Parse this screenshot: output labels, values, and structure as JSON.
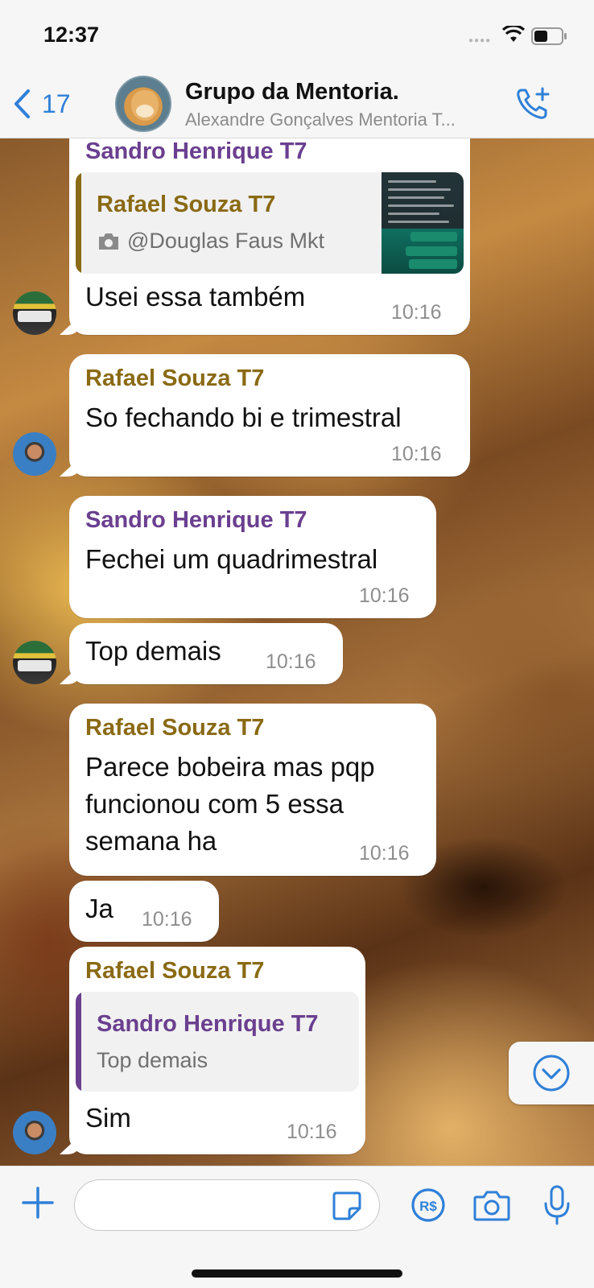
{
  "status_bar": {
    "time": "12:37"
  },
  "header": {
    "back_count": "17",
    "title": "Grupo da Mentoria.",
    "subtitle": "Alexandre Gonçalves Mentoria T..."
  },
  "messages": [
    {
      "sender": "Sandro Henrique T7",
      "quote": {
        "name": "Rafael Souza T7",
        "text": "@Douglas Faus Mkt",
        "has_photo": true
      },
      "text": "Usei essa também",
      "time": "10:16"
    },
    {
      "sender": "Rafael Souza T7",
      "text": "So fechando bi e trimestral",
      "time": "10:16"
    },
    {
      "sender": "Sandro Henrique T7",
      "text": "Fechei um quadrimestral",
      "time": "10:16"
    },
    {
      "text": "Top demais",
      "time": "10:16"
    },
    {
      "sender": "Rafael Souza T7",
      "lines": [
        "Parece bobeira mas pqp",
        "funcionou com 5 essa",
        "semana ha"
      ],
      "time": "10:16"
    },
    {
      "text": "Ja",
      "time": "10:16"
    },
    {
      "sender": "Rafael Souza T7",
      "quote": {
        "name": "Sandro Henrique T7",
        "text": "Top demais"
      },
      "text": "Sim",
      "time": "10:16"
    }
  ],
  "input": {
    "placeholder": ""
  },
  "colors": {
    "accent": "#2f80d8",
    "sender_purple": "#6a3f8f",
    "sender_gold": "#8a6a14"
  },
  "icons": [
    "back-chevron",
    "add-call",
    "scroll-down",
    "plus",
    "sticker",
    "pay-brl",
    "camera",
    "microphone"
  ]
}
